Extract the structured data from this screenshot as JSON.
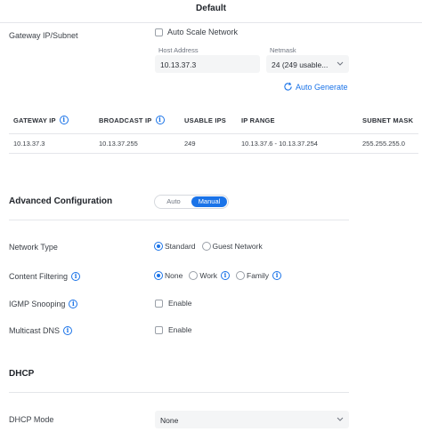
{
  "header": {
    "title": "Default"
  },
  "gateway": {
    "label": "Gateway IP/Subnet",
    "auto_scale_label": "Auto Scale Network",
    "host_address_label": "Host Address",
    "host_address_value": "10.13.37.3",
    "netmask_label": "Netmask",
    "netmask_value": "24 (249 usable...",
    "auto_generate_label": "Auto Generate"
  },
  "subnet_table": {
    "columns": [
      "GATEWAY IP",
      "BROADCAST IP",
      "USABLE IPS",
      "IP RANGE",
      "SUBNET MASK"
    ],
    "row": [
      "10.13.37.3",
      "10.13.37.255",
      "249",
      "10.13.37.6 - 10.13.37.254",
      "255.255.255.0"
    ]
  },
  "advanced": {
    "title": "Advanced Configuration",
    "modes": [
      "Auto",
      "Manual"
    ],
    "active_mode": "Manual"
  },
  "network_type": {
    "label": "Network Type",
    "options": [
      "Standard",
      "Guest Network"
    ],
    "selected": "Standard"
  },
  "content_filtering": {
    "label": "Content Filtering",
    "options": [
      "None",
      "Work",
      "Family"
    ],
    "selected": "None"
  },
  "igmp": {
    "label": "IGMP Snooping",
    "checkbox_label": "Enable"
  },
  "mdns": {
    "label": "Multicast DNS",
    "checkbox_label": "Enable"
  },
  "dhcp": {
    "title": "DHCP",
    "mode_label": "DHCP Mode",
    "mode_value": "None"
  },
  "colors": {
    "accent": "#1a73e8",
    "divider": "#e4e6ea",
    "field_bg": "#f4f5f6"
  }
}
